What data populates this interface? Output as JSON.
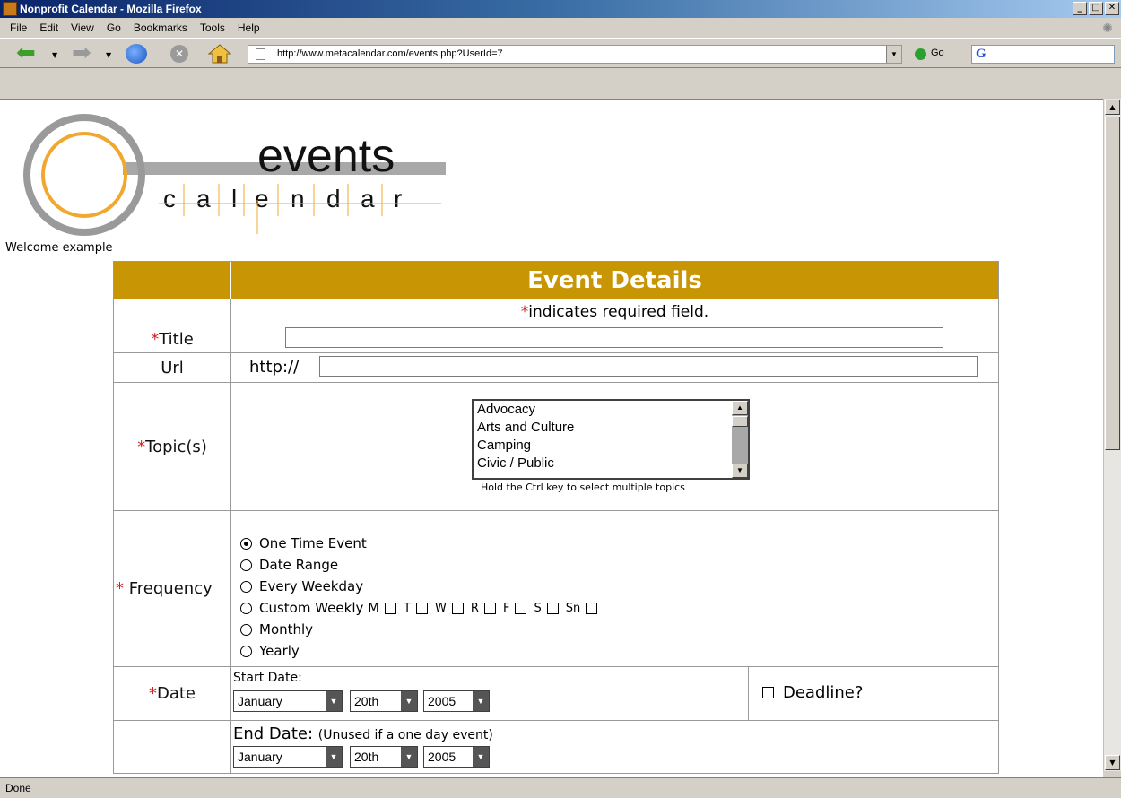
{
  "window": {
    "title": "Nonprofit Calendar - Mozilla Firefox"
  },
  "menu": {
    "items": [
      "File",
      "Edit",
      "View",
      "Go",
      "Bookmarks",
      "Tools",
      "Help"
    ]
  },
  "toolbar": {
    "url": "http://www.metacalendar.com/events.php?UserId=7",
    "go_label": "Go",
    "search_engine": "G"
  },
  "logo": {
    "top_word": "events",
    "letters": [
      "c",
      "a",
      "l",
      "e",
      "n",
      "d",
      "a",
      "r"
    ],
    "ring_outer_color": "#9a9a9a",
    "ring_inner_color": "#f0a830"
  },
  "page": {
    "welcome": "Welcome example"
  },
  "form": {
    "header": "Event Details",
    "header_color": "#c89605",
    "required_note": "indicates required field.",
    "required_mark": "*",
    "title_label": "Title",
    "url_label": "Url",
    "url_prefix": "http://",
    "topics_label": "Topic(s)",
    "topics": [
      "Advocacy",
      "Arts and Culture",
      "Camping",
      "Civic / Public"
    ],
    "topics_hint": "Hold the Ctrl key to select multiple topics",
    "frequency_label": "Frequency",
    "frequency_options": [
      "One Time Event",
      "Date Range",
      "Every Weekday",
      "Custom Weekly M",
      "Monthly",
      "Yearly"
    ],
    "frequency_selected": "One Time Event",
    "weekdays": [
      "T",
      "W",
      "R",
      "F",
      "S",
      "Sn"
    ],
    "date_label": "Date",
    "start_date_caption": "Start Date:",
    "start_month": "January",
    "start_day": "20th",
    "start_year": "2005",
    "deadline_label": "Deadline?",
    "end_date_caption": "End Date:",
    "end_date_note": "(Unused if a one day event)",
    "end_month": "January",
    "end_day": "20th",
    "end_year": "2005"
  },
  "status": {
    "text": "Done"
  }
}
